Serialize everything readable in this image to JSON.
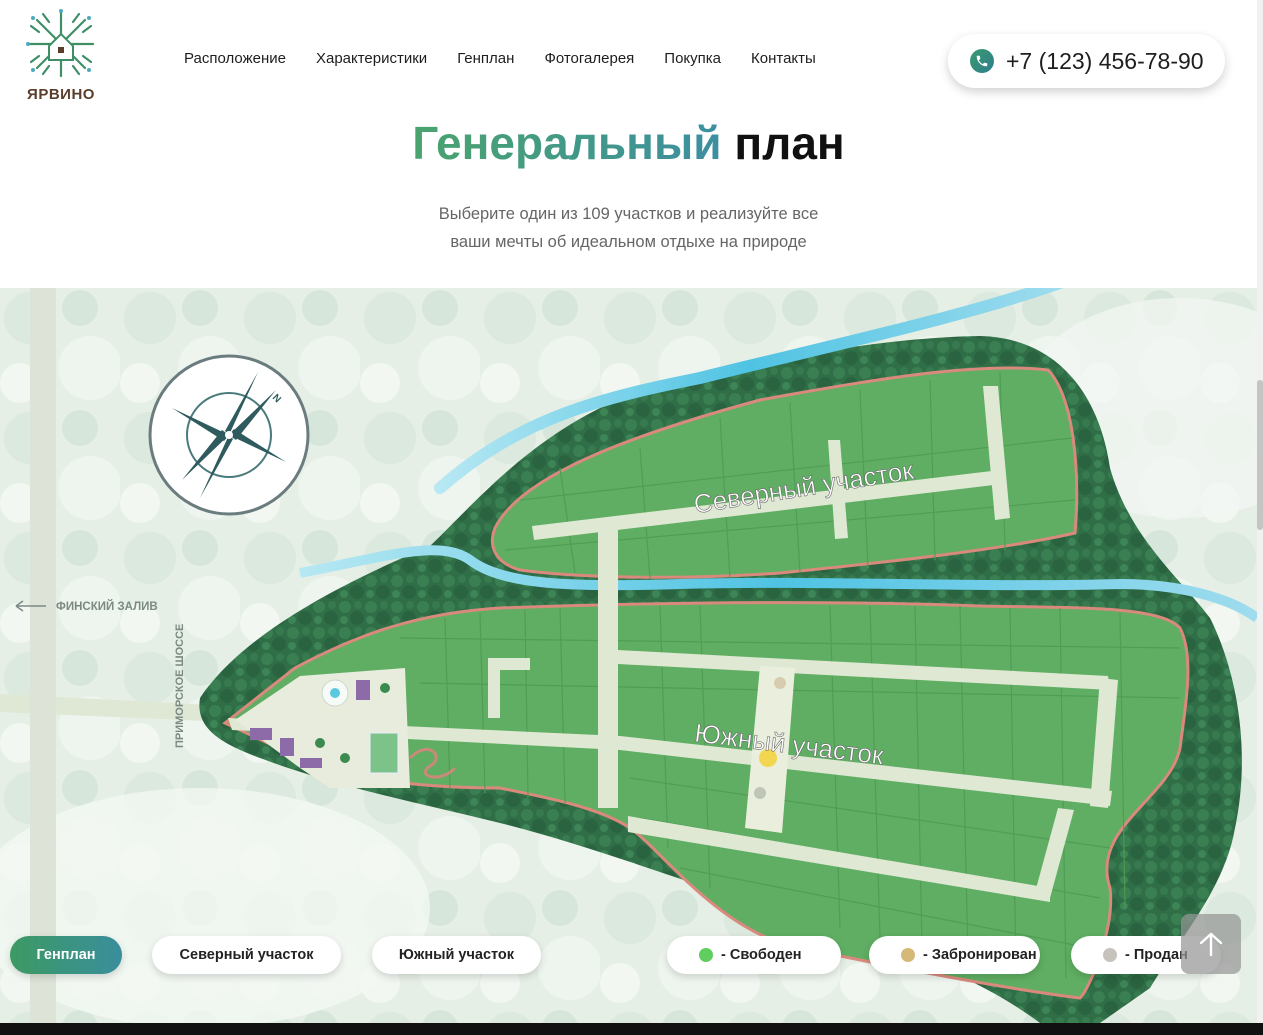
{
  "logo": {
    "text": "ЯРВИНО"
  },
  "nav": [
    {
      "label": "Расположение"
    },
    {
      "label": "Характеристики"
    },
    {
      "label": "Генплан"
    },
    {
      "label": "Фотогалерея"
    },
    {
      "label": "Покупка"
    },
    {
      "label": "Контакты"
    }
  ],
  "phone": {
    "number": "+7 (123) 456-78-90"
  },
  "title": {
    "accent": "Генеральный",
    "rest": "план"
  },
  "subtitle": {
    "line1": "Выберите один из 109 участков и реализуйте все",
    "line2": "ваши мечты об идеальном отдыхе на природе"
  },
  "map": {
    "north_label": "Северный участок",
    "south_label": "Южный участок",
    "gulf_label": "ФИНСКИЙ ЗАЛИВ",
    "road_label": "ПРИМОРСКОЕ ШОССЕ",
    "compass_letter": "N"
  },
  "tabs": [
    {
      "label": "Генплан",
      "active": true
    },
    {
      "label": "Северный участок",
      "active": false
    },
    {
      "label": "Южный участок",
      "active": false
    }
  ],
  "legend": [
    {
      "label": "- Свободен",
      "color": "#5fce5f"
    },
    {
      "label": "- Забронирован",
      "color": "#d6b878"
    },
    {
      "label": "- Продан",
      "color": "#c8c2bc"
    }
  ],
  "colors": {
    "accent_green": "#3c9a63",
    "accent_teal": "#3a8e9c",
    "forest": "#2f6e46",
    "plot": "#66b46a",
    "boundary": "#d98a7c",
    "river": "#6ecde8"
  },
  "icons": {
    "phone": "phone-icon",
    "scroll_top": "arrow-up-icon",
    "compass": "compass-icon",
    "back_arrow": "arrow-left-icon"
  }
}
